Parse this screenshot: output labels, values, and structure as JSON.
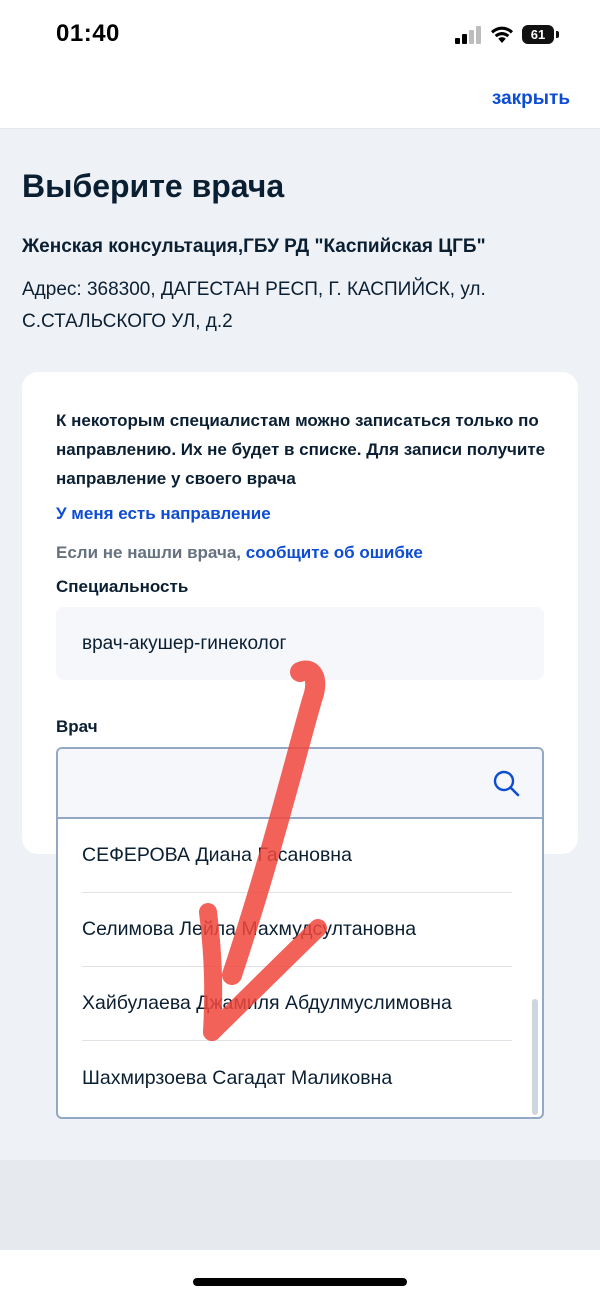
{
  "status_bar": {
    "time": "01:40",
    "battery": "61"
  },
  "header": {
    "close_label": "закрыть"
  },
  "page": {
    "title": "Выберите врача",
    "org_name": "Женская консультация,ГБУ РД \"Каспийская ЦГБ\"",
    "address": "Адрес: 368300, ДАГЕСТАН РЕСП, Г. КАСПИЙСК, ул. С.СТАЛЬСКОГО УЛ, д.2"
  },
  "card": {
    "notice": "К некоторым специалистам можно записаться только по направлению. Их не будет в списке. Для записи получите направление у своего врача",
    "referral_link": "У меня есть направление",
    "report_prefix": "Если не нашли врача,",
    "report_link": "сообщите об ошибке",
    "specialty_label": "Специальность",
    "specialty_value": "врач-акушер-гинеколог",
    "doctor_label": "Врач"
  },
  "doctor_search": {
    "value": "",
    "doctors": [
      "СЕФЕРОВА Диана Гасановна",
      "Селимова Лейла Махмудсултановна",
      "Хайбулаева Джамиля Абдулмуслимовна",
      "Шахмирзоева Сагадат Маликовна"
    ]
  },
  "colors": {
    "accent": "#0d4cd3",
    "annotation": "#f0473c"
  },
  "icons": [
    "search-icon",
    "signal-icon",
    "wifi-icon",
    "battery-icon"
  ]
}
